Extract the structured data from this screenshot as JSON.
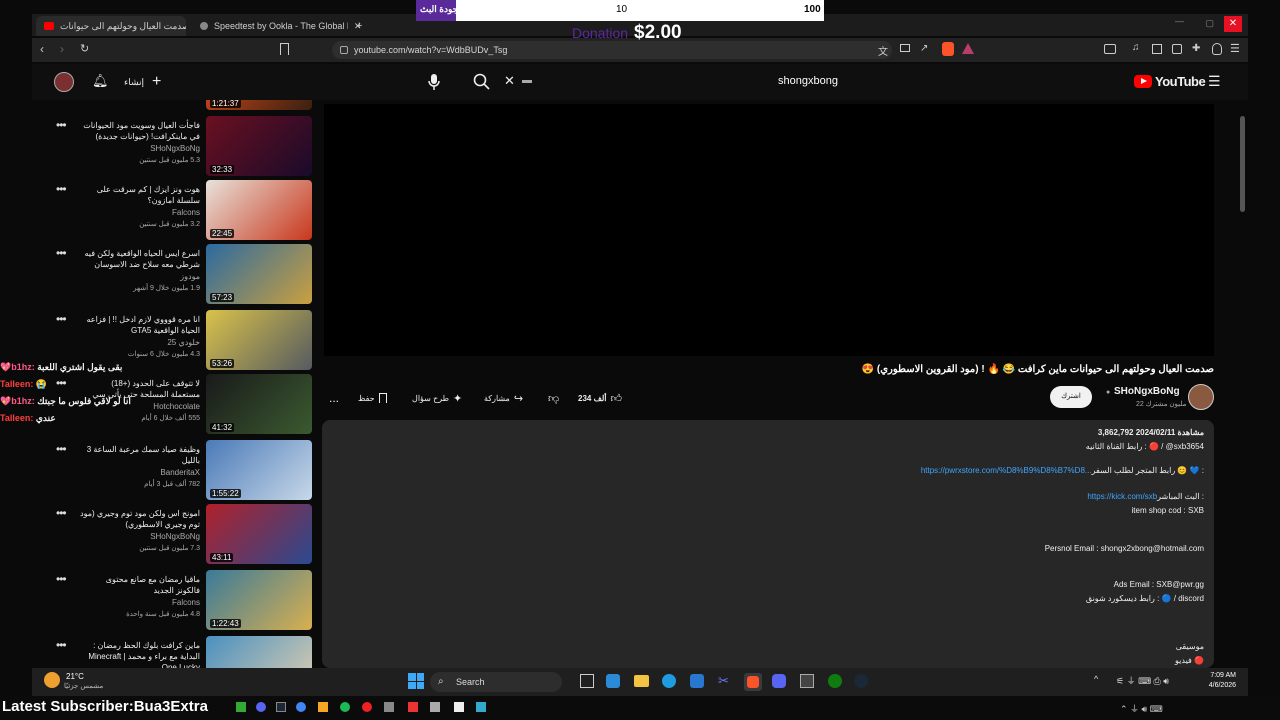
{
  "browser": {
    "tabs": [
      {
        "label": "صدمت العيال وحولتهم الى حيوانات",
        "close": "✕"
      },
      {
        "label": "Speedtest by Ookla - The Global Br",
        "close": "✕"
      }
    ],
    "new_tab": "+",
    "url": "youtube.com/watch?v=WdbBUDv_Tsg"
  },
  "overlay": {
    "left_label": "نطور جودة البث",
    "mid_value": "10",
    "right_value": "100"
  },
  "donation": {
    "ghost": "Donation",
    "amount": "$2.00"
  },
  "youtube": {
    "logo_text": "YouTube",
    "create_label": "إنشاء",
    "search_query": "shongxbong"
  },
  "recommendations": [
    {
      "title": "",
      "channel": "",
      "meta": "",
      "duration": "1:21:37",
      "colors": [
        "#c0441a",
        "#3a1f10"
      ]
    },
    {
      "title": "فاجأت العيال وسويت مود الحيوانات في ماينكرافت! (حيوانات جديدة)",
      "channel": "SHoNgxBoNg",
      "meta": "5.3 مليون قبل سنتين",
      "duration": "32:33",
      "colors": [
        "#6a1020",
        "#1a0a2a"
      ]
    },
    {
      "title": "هوت ونز ايزك | كم سرقت على سلسلة امازون؟",
      "channel": "Falcons",
      "meta": "3.2 مليون قبل سنتين",
      "duration": "22:45",
      "colors": [
        "#e8e2da",
        "#c8371c"
      ]
    },
    {
      "title": "اسرع ايس الحياه الواقعية ولكن فيه شرطي معه سلاح ضد الاسوسان",
      "channel": "مودوز",
      "meta": "1.9 مليون خلال 9 أشهر",
      "duration": "57:23",
      "colors": [
        "#2b6aa0",
        "#caa040"
      ]
    },
    {
      "title": "انا مره قوووي لازم ادخل !! | فزاعه الحياة الواقعية GTA5",
      "channel": "خلودي 25",
      "meta": "4.3 مليون خلال 6 سنوات",
      "duration": "53:26",
      "colors": [
        "#d9c24a",
        "#555a60"
      ]
    },
    {
      "title": "لا تتوقف على الحدود (+18) مستعملة المسلحة حتى يأتي سي",
      "channel": "Hotchocolate",
      "meta": "555 ألف خلال 6 أيام",
      "duration": "41:32",
      "colors": [
        "#1a1a1a",
        "#3a5a30"
      ]
    },
    {
      "title": "وظيفة صياد سمك مرعبة الساعة 3 بالليل",
      "channel": "BanderitaX",
      "meta": "782 ألف قبل 3 أيام",
      "duration": "1:55:22",
      "colors": [
        "#4a7ab8",
        "#c8d8e8"
      ]
    },
    {
      "title": "امونج اس ولكن مود توم وجيري (مود توم وجيري الاسطوري)",
      "channel": "SHoNgxBoNg",
      "meta": "7.3 مليون قبل سنتين",
      "duration": "43:11",
      "colors": [
        "#b0202a",
        "#2a4a90"
      ]
    },
    {
      "title": "ماقيا رمضان مع صانع محتوى فالكونز الجديد",
      "channel": "Falcons",
      "meta": "4.8 مليون قبل سنة واحدة",
      "duration": "1:22:43",
      "colors": [
        "#3a7a9a",
        "#d8b050"
      ]
    },
    {
      "title": "ماين كرافت بلوك الحظ رمضان : البداية مع براء و محمد | Minecraft One Lucky",
      "channel": "",
      "meta": "",
      "duration": "",
      "colors": [
        "#4a90c0",
        "#e0d0b0"
      ]
    }
  ],
  "video": {
    "title": "صدمت العيال وحولتهم الى حيوانات ماين كرافت 😂 🔥 ! (مود القروين الاسطوري) 😍",
    "channel": "SHoNgxBoNg",
    "subscribers": "22 مليون مشترك",
    "subscribe_label": "اشترك",
    "likes": "234 ألف",
    "share_label": "مشاركة",
    "ask_label": "طرح سؤال",
    "save_label": "حفظ",
    "more_label": "..."
  },
  "description": {
    "stats": "3,862,792 مشاهدة  2024/02/11",
    "lines": [
      {
        "text": "رابط القناة الثانيه : 🔴 / @sxb3654",
        "link": ""
      },
      {
        "text": "رابط المتجر لطلب السفر 😊 💙 :",
        "link": "https://pwrxstore.com/%D8%B9%D8%B7%D8..."
      },
      {
        "text": "البث المباشر :",
        "link": "https://kick.com/sxb"
      },
      {
        "text": "item shop cod : SXB",
        "link": ""
      },
      {
        "text": "Persnol Email : shongx2xbong@hotmail.com",
        "link": ""
      },
      {
        "text": "Ads Email : SXB@pwr.gg",
        "link": ""
      },
      {
        "text": "رابط ديسكورد شونق : 🔵 / discord",
        "link": ""
      },
      {
        "text": "موسيقى",
        "link": ""
      },
      {
        "text": "فيديو 🔴",
        "link": ""
      }
    ]
  },
  "chat": [
    {
      "user": "💖b1hz:",
      "message": "بقى يقول اشتري اللعبة"
    },
    {
      "user": "Talleen:",
      "message": "😭"
    },
    {
      "user": "💖b1hz:",
      "message": "انا لو لاقي فلوس ما جبتك"
    },
    {
      "user": "Talleen:",
      "message": "عندي"
    }
  ],
  "taskbar": {
    "weather_temp": "21°C",
    "weather_desc": "مشمس جزئيًا",
    "search_label": "Search",
    "time": "7:09 AM",
    "date": "4/6/2026"
  },
  "banner": {
    "text": "Latest Subscriber:Bua3Extra"
  },
  "colors": {
    "accent_red": "#ff0000",
    "link_blue": "#3ea6ff",
    "bg": "#0f0f0f"
  }
}
